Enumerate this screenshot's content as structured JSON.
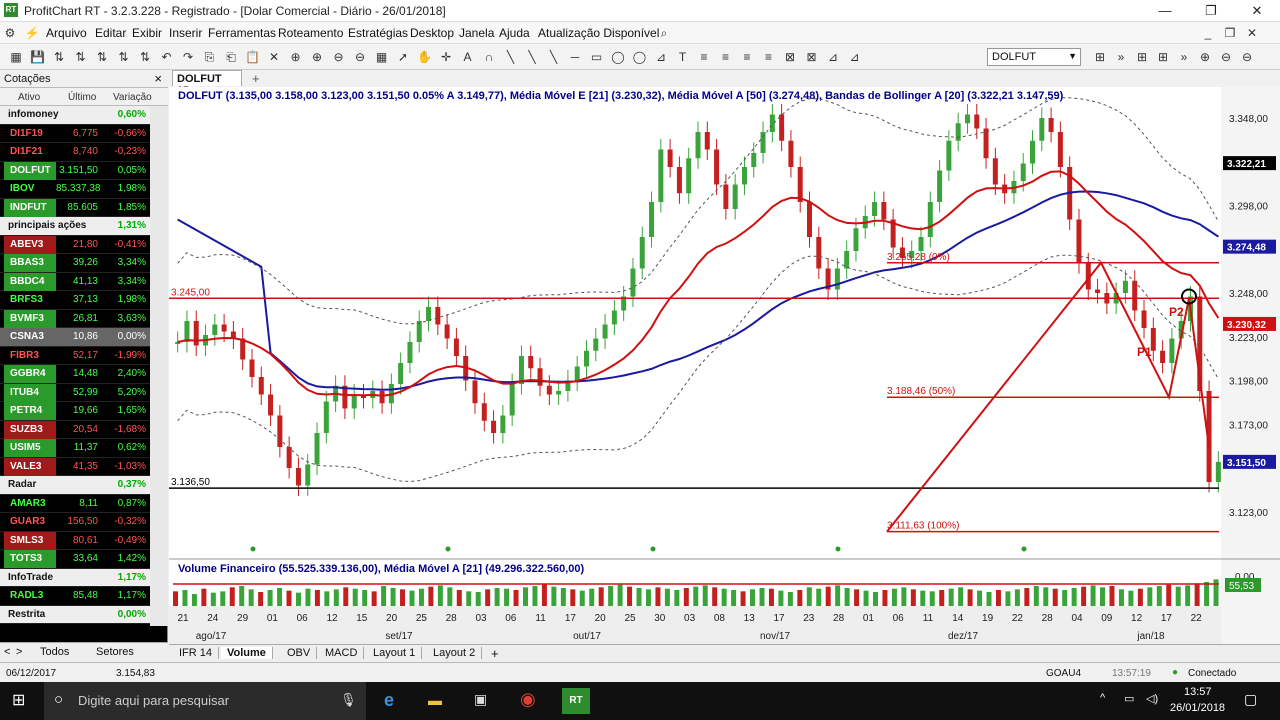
{
  "window": {
    "title": "ProfitChart RT - 3.2.3.228 - Registrado - [Dolar Comercial - Diário - 26/01/2018]",
    "app_icon": "RT"
  },
  "menu": [
    "Arquivo",
    "Editar",
    "Exibir",
    "Inserir",
    "Ferramentas",
    "Roteamento",
    "Estratégias",
    "Desktop",
    "Janela",
    "Ajuda",
    "Atualização Disponível"
  ],
  "symbol_input": "DOLFUT",
  "left_panel": {
    "title": "Cotações",
    "close": "×",
    "columns": [
      "Ativo",
      "Último",
      "Variação"
    ],
    "groups": [
      {
        "name": "infomoney",
        "change": "0,60%",
        "rows": [
          {
            "s": "DI1F19",
            "l": "6,775",
            "v": "-0,66%",
            "t": "dn"
          },
          {
            "s": "DI1F21",
            "l": "8,740",
            "v": "-0,23%",
            "t": "dn"
          },
          {
            "s": "DOLFUT",
            "l": "3.151,50",
            "v": "0,05%",
            "t": "upb"
          },
          {
            "s": "IBOV",
            "l": "85.337,38",
            "v": "1,98%",
            "t": "up"
          },
          {
            "s": "INDFUT",
            "l": "85.605",
            "v": "1,85%",
            "t": "upb"
          }
        ]
      },
      {
        "name": "principais ações",
        "change": "1,31%",
        "rows": [
          {
            "s": "ABEV3",
            "l": "21,80",
            "v": "-0,41%",
            "t": "dnb"
          },
          {
            "s": "BBAS3",
            "l": "39,26",
            "v": "3,34%",
            "t": "upb"
          },
          {
            "s": "BBDC4",
            "l": "41,13",
            "v": "3,34%",
            "t": "upb"
          },
          {
            "s": "BRFS3",
            "l": "37,13",
            "v": "1,98%",
            "t": "up"
          },
          {
            "s": "BVMF3",
            "l": "26,81",
            "v": "3,63%",
            "t": "upb"
          },
          {
            "s": "CSNA3",
            "l": "10,86",
            "v": "0,00%",
            "t": "flat"
          },
          {
            "s": "FIBR3",
            "l": "52,17",
            "v": "-1,99%",
            "t": "dn"
          },
          {
            "s": "GGBR4",
            "l": "14,48",
            "v": "2,40%",
            "t": "upb"
          },
          {
            "s": "ITUB4",
            "l": "52,99",
            "v": "5,20%",
            "t": "upb"
          },
          {
            "s": "PETR4",
            "l": "19,66",
            "v": "1,65%",
            "t": "upb"
          },
          {
            "s": "SUZB3",
            "l": "20,54",
            "v": "-1,68%",
            "t": "dnb"
          },
          {
            "s": "USIM5",
            "l": "11,37",
            "v": "0,62%",
            "t": "upb"
          },
          {
            "s": "VALE3",
            "l": "41,35",
            "v": "-1,03%",
            "t": "dnb"
          }
        ]
      },
      {
        "name": "Radar",
        "change": "0,37%",
        "rows": [
          {
            "s": "AMAR3",
            "l": "8,11",
            "v": "0,87%",
            "t": "up"
          },
          {
            "s": "GUAR3",
            "l": "156,50",
            "v": "-0,32%",
            "t": "dn"
          },
          {
            "s": "SMLS3",
            "l": "80,61",
            "v": "-0,49%",
            "t": "dnb"
          },
          {
            "s": "TOTS3",
            "l": "33,64",
            "v": "1,42%",
            "t": "upb"
          }
        ]
      },
      {
        "name": "InfoTrade",
        "change": "1,17%",
        "rows": [
          {
            "s": "RADL3",
            "l": "85,48",
            "v": "1,17%",
            "t": "up"
          }
        ]
      },
      {
        "name": "Restrita",
        "change": "0,00%",
        "rows": []
      }
    ],
    "tabs": [
      "Todos",
      "Setores"
    ]
  },
  "chart": {
    "tab": "DOLFUT 1D",
    "legend": "DOLFUT (3.135,00  3.158,00  3.123,00  3.151,50  0.05%  A 3.149,77), Média Móvel E [21] (3.230,32), Média Móvel A [50] (3.274,48), Bandas de Bollinger A [20] (3.322,21  3.147,59)",
    "vol_legend": "Volume Financeiro (55.525.339.136,00), Média Móvel A [21] (49.296.322.560,00)",
    "fib": [
      "3.265,28 (0%)",
      "3.188,46 (50%)",
      "3.111,63 (100%)"
    ],
    "hlines": [
      "3.245,00",
      "3.136,50"
    ],
    "pivots": [
      "P1",
      "P2"
    ],
    "vol_axis": [
      "0,00",
      "55,53"
    ],
    "bottom_tabs": [
      "IFR 14",
      "Volume",
      "OBV",
      "MACD",
      "Layout 1",
      "Layout 2"
    ]
  },
  "chart_data": {
    "type": "candlestick",
    "y_ticks": [
      3348,
      3298,
      3248,
      3223,
      3198,
      3173,
      3123
    ],
    "y_tick_labels": [
      "3.348,00",
      "3.298,00",
      "3.248,00",
      "3.223,00",
      "3.198,00",
      "3.173,00",
      "3.123,00"
    ],
    "price_tags": [
      {
        "label": "3.322,21",
        "color": "#000000",
        "v": 3322.21
      },
      {
        "label": "3.274,48",
        "color": "#1a1aa0",
        "v": 3274.48
      },
      {
        "label": "3.230,32",
        "color": "#d01010",
        "v": 3230.32
      },
      {
        "label": "3.151,50",
        "color": "#1a1aa0",
        "v": 3151.5
      }
    ],
    "x_labels": [
      "21",
      "24",
      "29",
      "01",
      "06",
      "12",
      "15",
      "20",
      "25",
      "28",
      "03",
      "06",
      "11",
      "17",
      "20",
      "25",
      "30",
      "03",
      "08",
      "13",
      "17",
      "23",
      "28",
      "01",
      "06",
      "11",
      "14",
      "19",
      "22",
      "28",
      "04",
      "09",
      "12",
      "17",
      "22"
    ],
    "months": [
      "ago/17",
      "set/17",
      "out/17",
      "nov/17",
      "dez/17",
      "jan/18"
    ],
    "closes": [
      3220,
      3232,
      3218,
      3224,
      3230,
      3226,
      3222,
      3210,
      3200,
      3190,
      3178,
      3160,
      3148,
      3138,
      3150,
      3168,
      3186,
      3195,
      3182,
      3190,
      3188,
      3192,
      3185,
      3196,
      3208,
      3220,
      3232,
      3240,
      3230,
      3222,
      3212,
      3198,
      3185,
      3175,
      3168,
      3178,
      3196,
      3212,
      3205,
      3195,
      3190,
      3192,
      3198,
      3206,
      3215,
      3222,
      3230,
      3238,
      3246,
      3262,
      3280,
      3300,
      3330,
      3320,
      3305,
      3325,
      3340,
      3330,
      3310,
      3296,
      3310,
      3320,
      3328,
      3340,
      3350,
      3335,
      3320,
      3300,
      3280,
      3262,
      3250,
      3262,
      3272,
      3285,
      3292,
      3300,
      3290,
      3274,
      3268,
      3272,
      3280,
      3300,
      3318,
      3335,
      3345,
      3350,
      3342,
      3325,
      3310,
      3305,
      3312,
      3322,
      3335,
      3348,
      3340,
      3320,
      3290,
      3265,
      3250,
      3248,
      3242,
      3248,
      3255,
      3238,
      3228,
      3215,
      3208,
      3222,
      3232,
      3246,
      3192,
      3140,
      3151.5
    ],
    "volumes": [
      22,
      24,
      18,
      26,
      20,
      22,
      28,
      30,
      25,
      21,
      24,
      27,
      23,
      20,
      26,
      24,
      22,
      25,
      28,
      26,
      24,
      22,
      30,
      27,
      25,
      23,
      26,
      29,
      31,
      28,
      24,
      22,
      21,
      25,
      27,
      26,
      24,
      28,
      30,
      33,
      29,
      27,
      25,
      23,
      26,
      28,
      30,
      32,
      29,
      27,
      25,
      28,
      26,
      24,
      27,
      29,
      31,
      28,
      26,
      24,
      22,
      25,
      27,
      26,
      23,
      21,
      24,
      28,
      26,
      29,
      31,
      27,
      25,
      23,
      21,
      24,
      26,
      28,
      25,
      23,
      22,
      24,
      26,
      28,
      25,
      23,
      21,
      24,
      22,
      25,
      27,
      30,
      28,
      26,
      24,
      27,
      29,
      31,
      28,
      30,
      25,
      23,
      26,
      28,
      30,
      32,
      29,
      31,
      34,
      36,
      40
    ]
  }
}
